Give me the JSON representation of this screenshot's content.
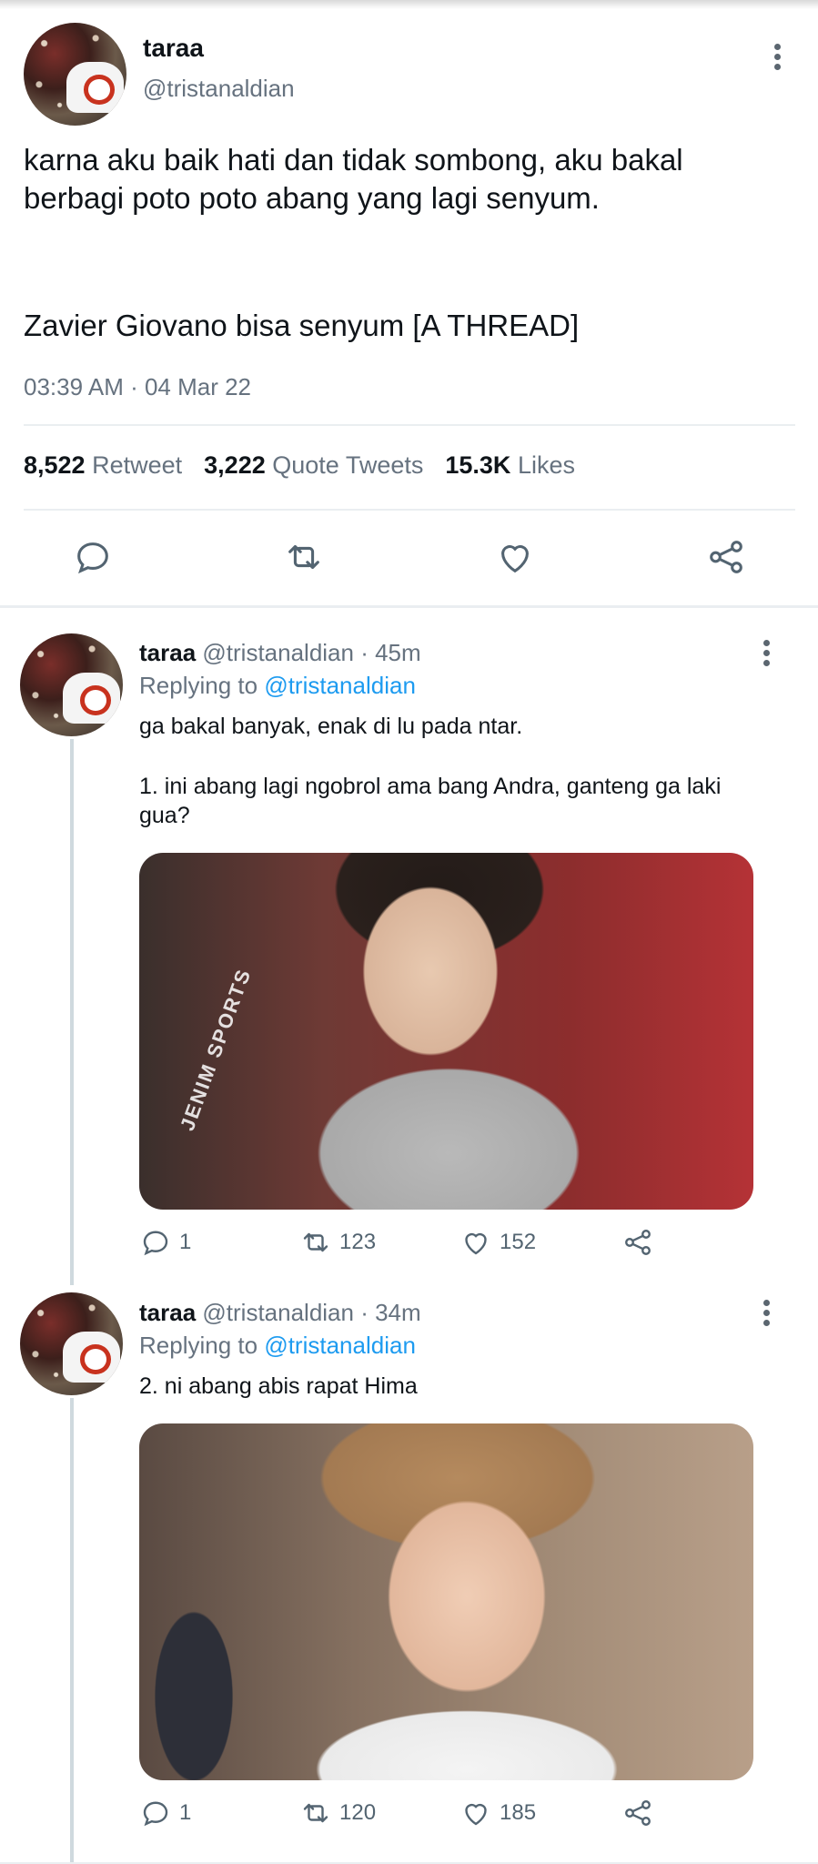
{
  "main_tweet": {
    "name": "taraa",
    "handle": "@tristanaldian",
    "text_line1": "karna aku baik hati dan tidak sombong, aku bakal berbagi poto poto abang yang lagi senyum.",
    "text_line2": "Zavier Giovano bisa senyum [A THREAD]",
    "timestamp": "03:39 AM · 04 Mar 22",
    "stats": {
      "retweets": "8,522",
      "retweets_label": "Retweet",
      "quotes": "3,222",
      "quotes_label": "Quote Tweets",
      "likes": "15.3K",
      "likes_label": "Likes"
    },
    "actions": [
      "reply-icon",
      "retweet-icon",
      "like-icon",
      "share-icon"
    ]
  },
  "replies": [
    {
      "name": "taraa",
      "handle": "@tristanaldian · 45m",
      "replying_prefix": "Replying to",
      "replying_to": "@tristanaldian",
      "text1": "ga bakal banyak, enak di lu pada ntar.",
      "text2": "1. ini abang lagi ngobrol ama bang Andra, ganteng ga laki gua?",
      "media_text": "JENIM SPORTS",
      "counts": {
        "replies": "1",
        "retweets": "123",
        "likes": "152"
      }
    },
    {
      "name": "taraa",
      "handle": "@tristanaldian · 34m",
      "replying_prefix": "Replying to",
      "replying_to": "@tristanaldian",
      "text1": "2. ni abang abis rapat Hima",
      "counts": {
        "replies": "1",
        "retweets": "120",
        "likes": "185"
      }
    }
  ],
  "colors": {
    "accent": "#1d9bf0",
    "secondary_text": "#66727f"
  }
}
